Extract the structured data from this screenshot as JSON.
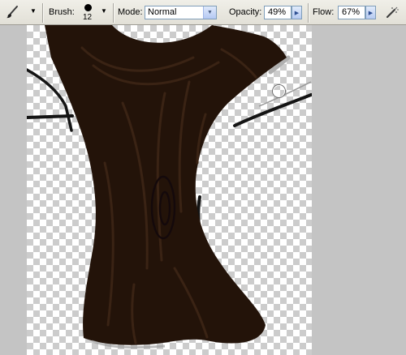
{
  "options_bar": {
    "tool_preset_icon": "brush-icon",
    "brush_label": "Brush:",
    "brush_size": "12",
    "mode_label": "Mode:",
    "mode_value": "Normal",
    "opacity_label": "Opacity:",
    "opacity_value": "49%",
    "flow_label": "Flow:",
    "flow_value": "67%",
    "airbrush_icon": "airbrush-icon"
  },
  "canvas": {
    "content": "tree-trunk-painting",
    "background": "transparency-checkerboard",
    "cursor": "brush-cursor-circle"
  },
  "colors": {
    "trunk": "#231309",
    "trunk_highlight": "#3a2314",
    "bar_bg": "#ebe9e1"
  }
}
